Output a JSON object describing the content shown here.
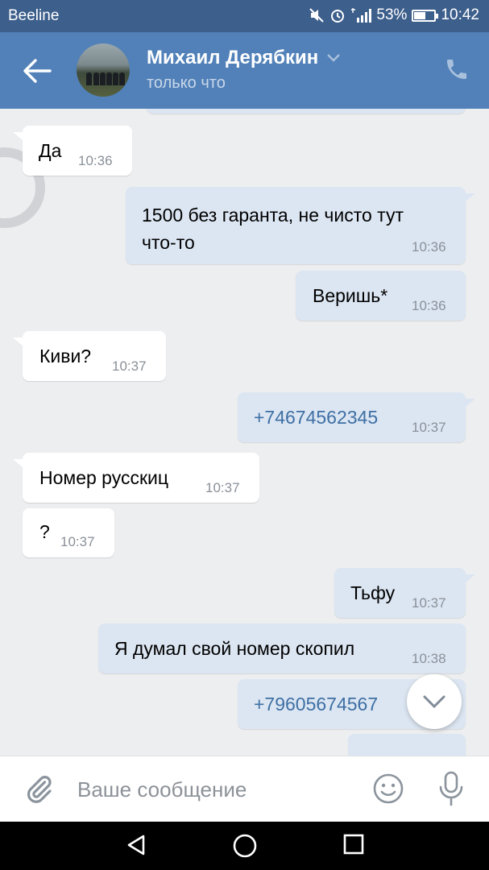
{
  "status_bar": {
    "carrier": "Beeline",
    "battery": "53%",
    "battery_level": 0.53,
    "time": "10:42"
  },
  "header": {
    "name": "Михаил Дерябкин",
    "status": "только что"
  },
  "messages": [
    {
      "dir": "in",
      "text": "Да",
      "time": "10:36"
    },
    {
      "dir": "out",
      "text": "1500 без гаранта, не чисто тут\nчто-то",
      "time": "10:36"
    },
    {
      "dir": "out",
      "text": "Веришь*",
      "time": "10:36"
    },
    {
      "dir": "in",
      "text": "Киви?",
      "time": "10:37"
    },
    {
      "dir": "out",
      "text": "+74674562345",
      "time": "10:37",
      "link": true
    },
    {
      "dir": "in",
      "text": "Номер русскиц",
      "time": "10:37"
    },
    {
      "dir": "in",
      "text": "?",
      "time": "10:37"
    },
    {
      "dir": "out",
      "text": "Тьфу",
      "time": "10:37"
    },
    {
      "dir": "out",
      "text": "Я думал свой номер скопил",
      "time": "10:38"
    },
    {
      "dir": "out",
      "text": "+79605674567",
      "time": "",
      "link": true
    }
  ],
  "composer": {
    "placeholder": "Ваше сообщение"
  },
  "icons": {
    "back": "arrow-left-icon",
    "dropdown": "chevron-down-icon",
    "call": "phone-icon",
    "attach": "paperclip-icon",
    "emoji": "smile-icon",
    "mic": "microphone-icon",
    "scroll": "chevron-down-icon",
    "nav_back": "triangle-back-icon",
    "nav_home": "circle-home-icon",
    "nav_recent": "square-recent-icon"
  },
  "colors": {
    "header": "#5181b8",
    "status_bar": "#3d5f8c",
    "incoming": "#ffffff",
    "outgoing": "#dce6f2",
    "link": "#3e6fa4",
    "background": "#edeef0"
  }
}
